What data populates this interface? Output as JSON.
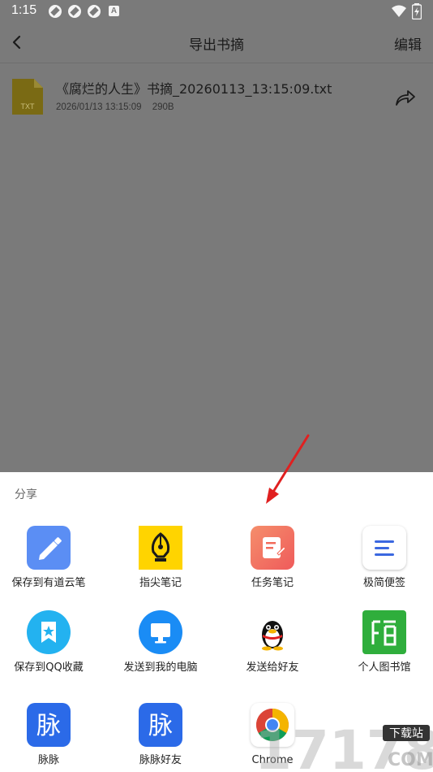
{
  "status_bar": {
    "time": "1:15",
    "a_glyph": "A",
    "icons": [
      "app-notification-icon",
      "app-notification-icon",
      "app-notification-icon",
      "a-notification-icon",
      "wifi-icon",
      "battery-charging-icon"
    ]
  },
  "header": {
    "title": "导出书摘",
    "edit_label": "编辑",
    "back_icon": "chevron-left-icon"
  },
  "file": {
    "name": "《腐烂的人生》书摘_20260113_13:15:09.txt",
    "date": "2026/01/13 13:15:09",
    "size": "290B",
    "icon_label": "TXT",
    "icon_color": "#7a6a14"
  },
  "share_sheet": {
    "title": "分享",
    "apps": [
      {
        "label": "保存到有道云笔记",
        "icon": "youdao-note-icon",
        "color": "#5b8ef4"
      },
      {
        "label": "指尖笔记",
        "icon": "fountain-pen-icon",
        "color": "#ffd400"
      },
      {
        "label": "任务笔记",
        "icon": "task-note-icon",
        "color": "#f26b5b"
      },
      {
        "label": "极简便签",
        "icon": "memo-icon",
        "color": "#ffffff"
      },
      {
        "label": "保存到QQ收藏",
        "icon": "qq-favorites-icon",
        "color": "#23b2f0"
      },
      {
        "label": "发送到我的电脑",
        "icon": "computer-icon",
        "color": "#1a8cf5"
      },
      {
        "label": "发送给好友",
        "icon": "qq-penguin-icon",
        "color": "#ffffff"
      },
      {
        "label": "个人图书馆",
        "icon": "library-icon",
        "color": "#2fae3c"
      },
      {
        "label": "脉脉",
        "icon": "maimai-icon",
        "color": "#2b6ae8"
      },
      {
        "label": "脉脉好友",
        "icon": "maimai-icon",
        "color": "#2b6ae8"
      },
      {
        "label": "Chrome",
        "icon": "chrome-icon",
        "color": "#ffffff"
      }
    ]
  },
  "colors": {
    "scrim": "#7a7a7a",
    "sheet": "#ffffff",
    "arrow": "#e02020"
  },
  "watermark": {
    "text": "17178",
    "badge": "下载站",
    "domain": "COM"
  }
}
